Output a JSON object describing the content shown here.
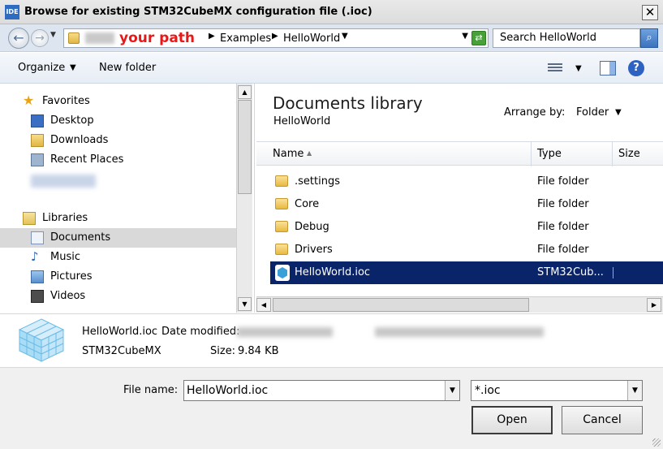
{
  "window": {
    "icon_text": "IDE",
    "title": "Browse for existing STM32CubeMX configuration file (.ioc)",
    "close_glyph": "✕"
  },
  "address": {
    "annotation": "your path",
    "crumbs": [
      "Examples",
      "HelloWorld"
    ],
    "search_placeholder": "Search HelloWorld"
  },
  "toolbar": {
    "organize": "Organize",
    "new_folder": "New folder"
  },
  "nav": {
    "favorites_label": "Favorites",
    "favorites": [
      "Desktop",
      "Downloads",
      "Recent Places"
    ],
    "libraries_label": "Libraries",
    "libraries": [
      "Documents",
      "Music",
      "Pictures",
      "Videos"
    ],
    "selected": "Documents"
  },
  "content": {
    "library_title": "Documents library",
    "library_sub": "HelloWorld",
    "arrange_label": "Arrange by:",
    "arrange_value": "Folder",
    "columns": {
      "name": "Name",
      "type": "Type",
      "size": "Size"
    },
    "files": [
      {
        "name": ".settings",
        "type": "File folder",
        "kind": "folder"
      },
      {
        "name": "Core",
        "type": "File folder",
        "kind": "folder"
      },
      {
        "name": "Debug",
        "type": "File folder",
        "kind": "folder"
      },
      {
        "name": "Drivers",
        "type": "File folder",
        "kind": "folder"
      },
      {
        "name": "HelloWorld.ioc",
        "type": "STM32Cub...",
        "kind": "ioc",
        "selected": true
      }
    ]
  },
  "details": {
    "filename": "HelloWorld.ioc",
    "date_label": "Date modified:",
    "app": "STM32CubeMX",
    "size_label": "Size:",
    "size_value": "9.84 KB"
  },
  "bottom": {
    "file_name_label": "File name:",
    "file_name_value": "HelloWorld.ioc",
    "file_type_value": "*.ioc",
    "open": "Open",
    "cancel": "Cancel"
  },
  "colors": {
    "selection": "#0a246a",
    "annotation": "#e81818",
    "address_bar": "#dde6f0"
  }
}
